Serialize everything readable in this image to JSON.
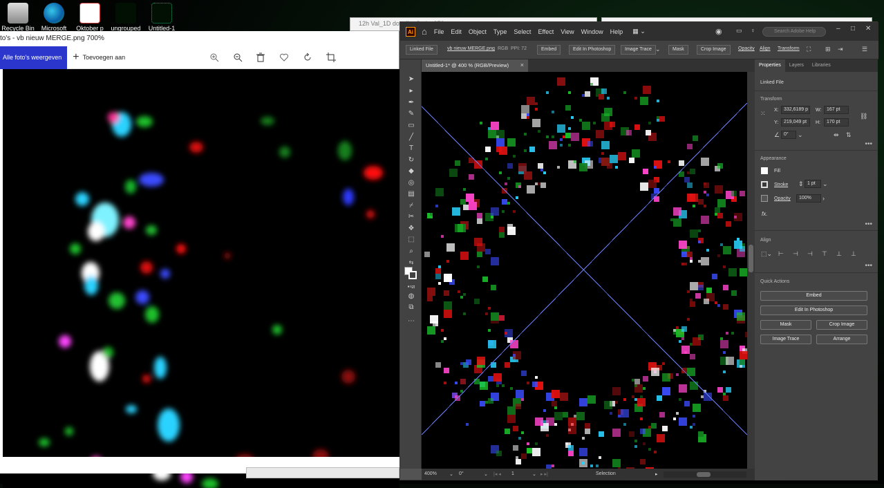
{
  "desktop": {
    "icons": [
      {
        "label": "Recycle Bin"
      },
      {
        "label": "Microsoft"
      },
      {
        "label": "Oktober p"
      },
      {
        "label": "ungrouped"
      },
      {
        "label": "Untitled-1"
      }
    ],
    "background_windows": [
      {
        "title": "12h Val_1D dow IL - Series050"
      }
    ]
  },
  "photos": {
    "title": "to's - vb nieuw MERGE.png   700%",
    "all_photos_button": "Alle foto's weergeven",
    "add_to_button": "Toevoegen aan",
    "icons": [
      "zoom-in-icon",
      "zoom-out-icon",
      "delete-icon",
      "favorite-icon",
      "rotate-icon",
      "crop-icon"
    ],
    "accent": "#2b36cc"
  },
  "illustrator": {
    "logo": "Ai",
    "menu": [
      "File",
      "Edit",
      "Object",
      "Type",
      "Select",
      "Effect",
      "View",
      "Window",
      "Help"
    ],
    "search_placeholder": "Search Adobe Help",
    "control_bar": {
      "linked_file": "Linked File",
      "file_name": "vb nieuw MERGE.png",
      "color_mode": "RGB",
      "ppi": "PPI: 72",
      "embed": "Embed",
      "edit_in_photoshop": "Edit In Photoshop",
      "image_trace": "Image Trace",
      "mask": "Mask",
      "crop_image": "Crop Image",
      "opacity": "Opacity",
      "align": "Align",
      "transform": "Transform"
    },
    "document_tab": "Untitled-1* @ 400 % (RGB/Preview)",
    "status_bar": {
      "zoom": "400%",
      "rotation": "0°",
      "artboard": "1",
      "tool": "Selection"
    },
    "panel": {
      "tabs": [
        "Properties",
        "Layers",
        "Libraries"
      ],
      "selection_type": "Linked File",
      "transform": {
        "heading": "Transform",
        "x_label": "X:",
        "x_value": "332,6189 p",
        "y_label": "Y:",
        "y_value": "219,049 pt",
        "w_label": "W:",
        "w_value": "167 pt",
        "h_label": "H:",
        "h_value": "170 pt",
        "angle_value": "0°"
      },
      "appearance": {
        "heading": "Appearance",
        "fill": "Fill",
        "stroke": "Stroke",
        "stroke_weight": "1 pt",
        "opacity": "Opacity",
        "opacity_value": "100%"
      },
      "align_heading": "Align",
      "quick_actions": {
        "heading": "Quick Actions",
        "embed": "Embed",
        "edit_in_photoshop": "Edit In Photoshop",
        "mask": "Mask",
        "crop_image": "Crop Image",
        "image_trace": "Image Trace",
        "arrange": "Arrange"
      }
    }
  }
}
